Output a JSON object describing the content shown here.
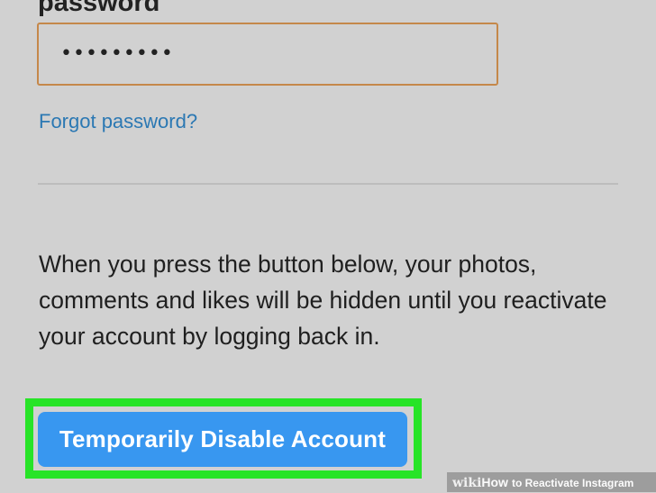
{
  "password_section": {
    "label": "password",
    "value": "•••••••••"
  },
  "forgot_password": {
    "label": "Forgot password?"
  },
  "info": {
    "text": "When you press the button below, your photos, comments and likes will be hidden until you reactivate your account by logging back in."
  },
  "actions": {
    "disable_label": "Temporarily Disable Account"
  },
  "watermark": {
    "wiki": "wiki",
    "how": "How",
    "rest": "to Reactivate Instagram"
  },
  "colors": {
    "background": "#d1d1d1",
    "input_border": "#c5884a",
    "link": "#2b78b3",
    "button": "#3897f0",
    "highlight": "#27e427"
  }
}
